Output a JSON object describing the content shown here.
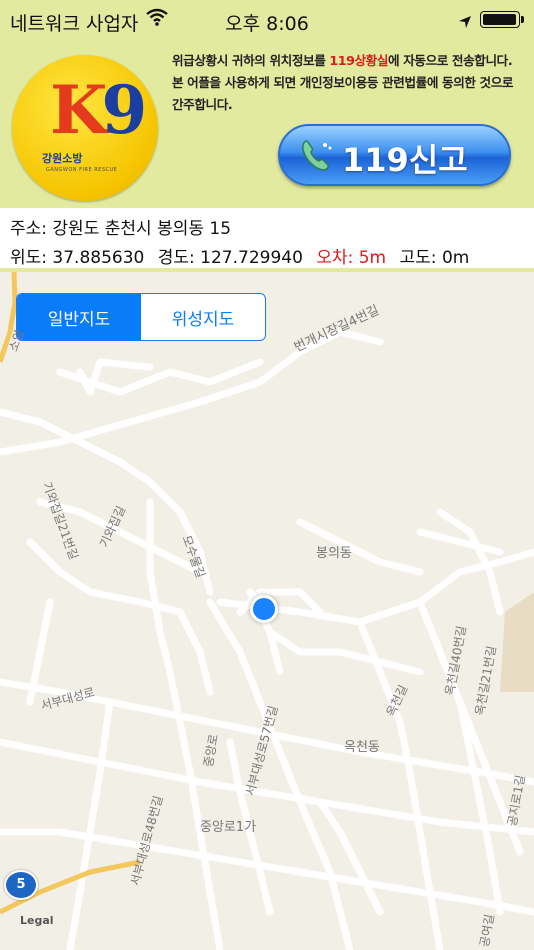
{
  "status_bar": {
    "carrier": "네트워크 사업자",
    "time": "오후 8:06",
    "battery_level": 1.0
  },
  "header": {
    "logo": {
      "mark": "K9",
      "name": "강원소방",
      "tagline": "GANGWON FIRE RESCUE"
    },
    "notice": {
      "part1": "위급상황시 귀하의 위치정보를 ",
      "highlight": "119상황실",
      "part2": "에 자동으로 전송합니다. 본 어플을 사용하게 되면 개인정보이용등 관련법률에 동의한 것으로 간주합니다."
    },
    "call_button_label": "119신고"
  },
  "info": {
    "address": "주소: 강원도 춘천시 봉의동 15",
    "latitude": "위도: 37.885630",
    "longitude": "경도: 127.729940",
    "error": "오차: 5m",
    "altitude": "고도: 0m"
  },
  "map": {
    "segments": {
      "standard": "일반지도",
      "satellite": "위성지도"
    },
    "active_segment": "standard",
    "labels": {
      "road1": "번개시장길4번길",
      "road2": "기와집길21번길",
      "road3": "기와집길",
      "road4": "모수물길",
      "dong1": "봉의동",
      "road5": "옥천길40번길",
      "road6": "옥천길21번길",
      "road7": "서부대성로",
      "road8": "중앙로",
      "road9": "서부대성로57번길",
      "road10": "옥천길",
      "dong2": "옥천동",
      "road11": "서부대성로48번길",
      "area1": "중앙로1가",
      "road12": "공지로1길",
      "road13": "공여길",
      "road14": "공지로",
      "road15": "소양"
    },
    "route_shield": "5",
    "legal": "Legal",
    "colors": {
      "road": "#ffffff",
      "land": "#f2efe6",
      "park": "#e8ddc4",
      "user_dot": "#1a82fb"
    }
  }
}
